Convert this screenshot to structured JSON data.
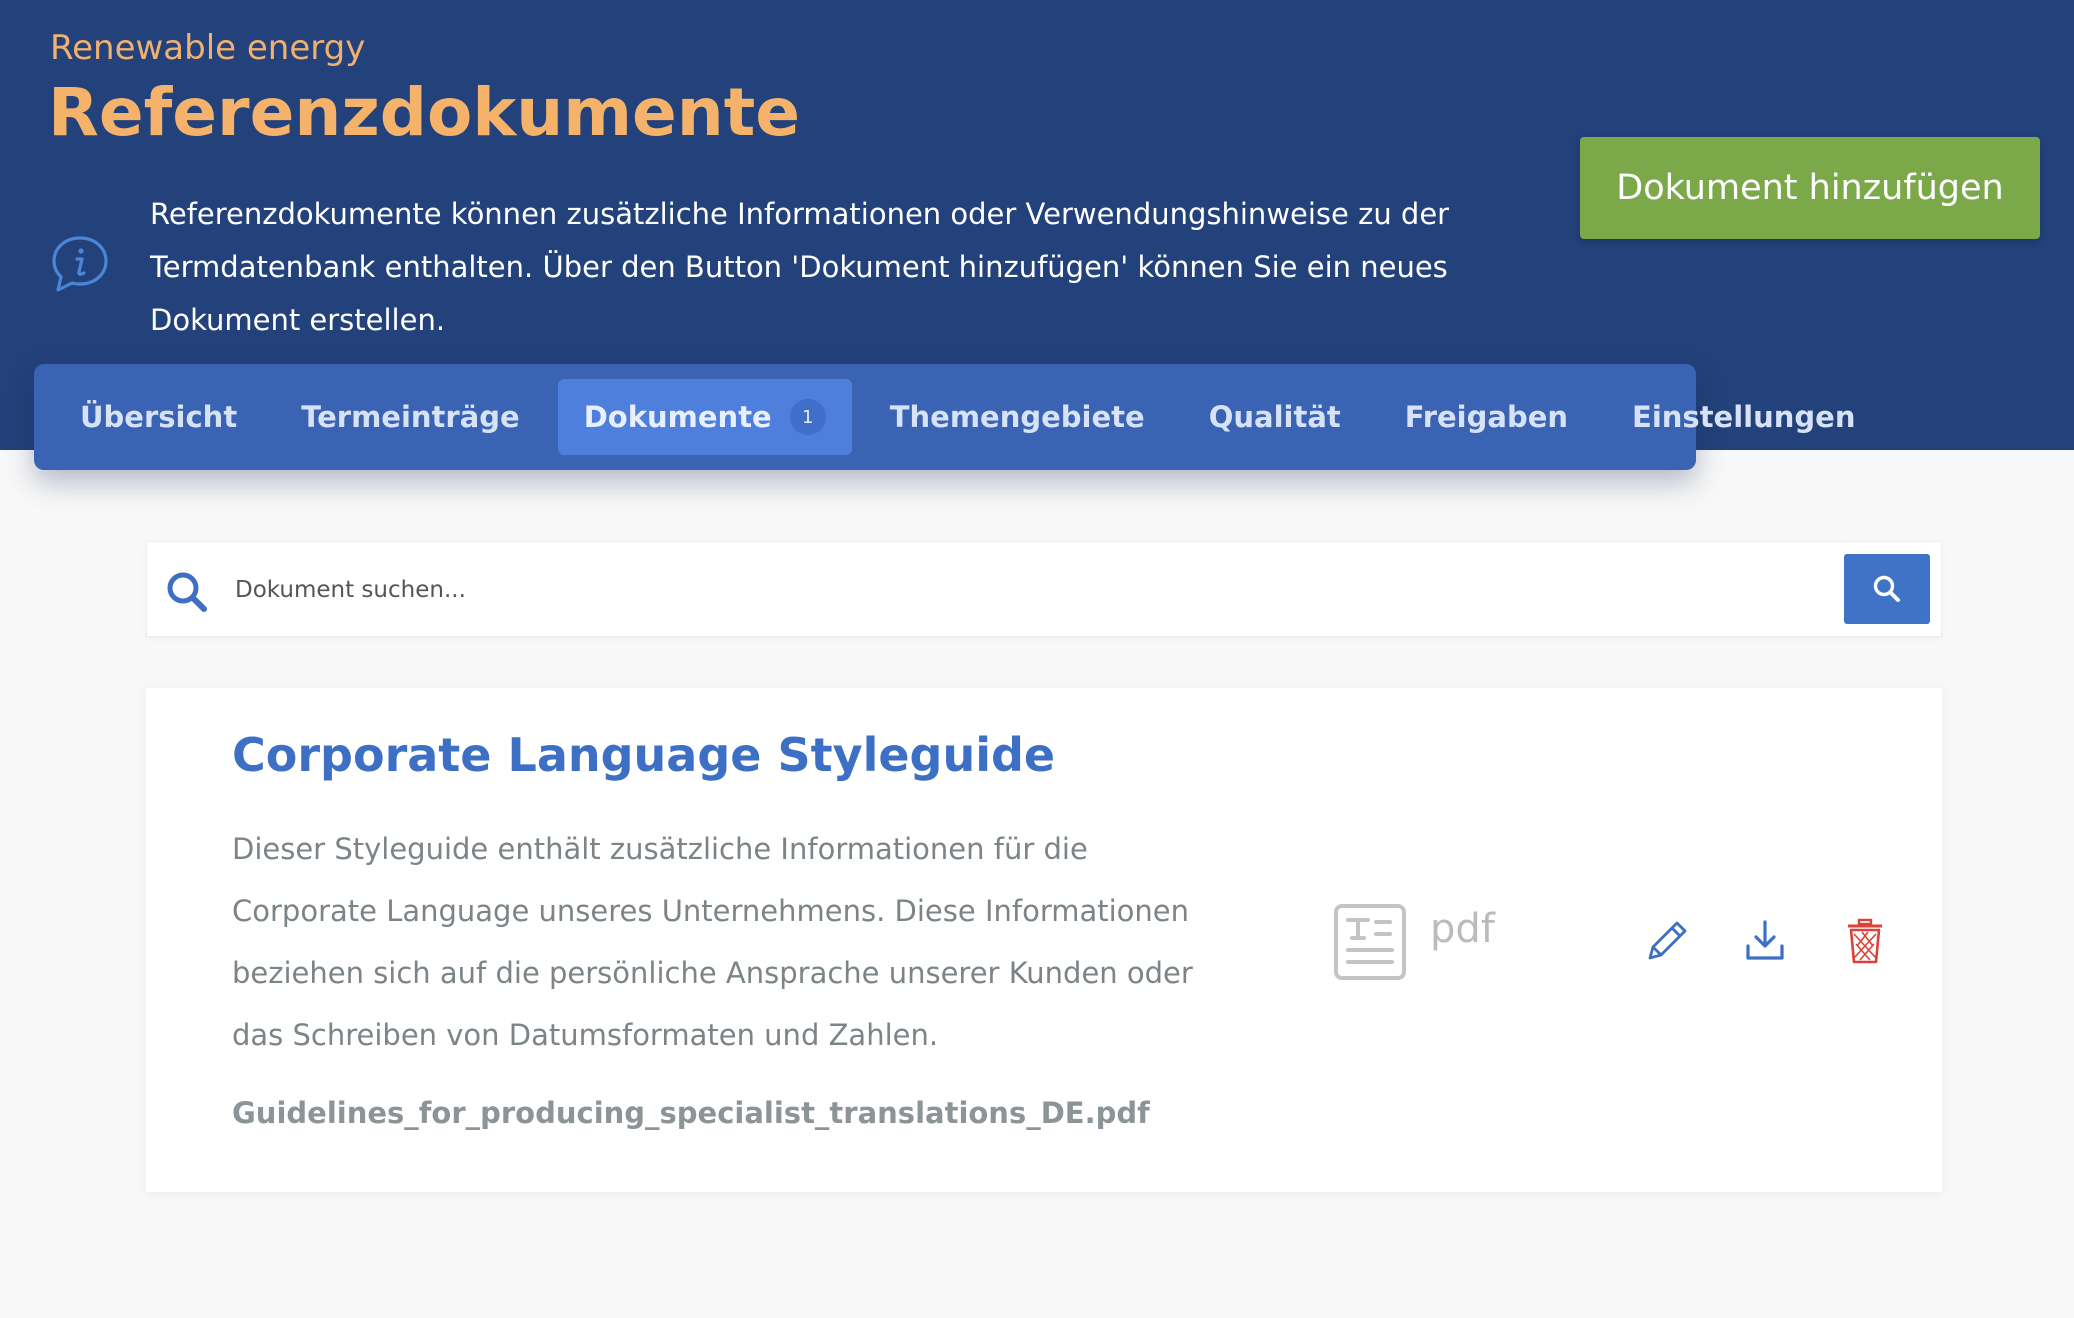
{
  "header": {
    "project_name": "Renewable energy",
    "page_title": "Referenzdokumente",
    "info_text": "Referenzdokumente können zusätzliche Informationen oder Verwendungshinweise zu der Termdatenbank enthalten. Über den Button 'Dokument hinzufügen' können Sie ein neues Dokument erstellen.",
    "add_button_label": "Dokument hinzufügen"
  },
  "tabs": [
    {
      "label": "Übersicht"
    },
    {
      "label": "Termeinträge"
    },
    {
      "label": "Dokumente",
      "badge": "1",
      "active": true
    },
    {
      "label": "Themengebiete"
    },
    {
      "label": "Qualität"
    },
    {
      "label": "Freigaben"
    },
    {
      "label": "Einstellungen"
    }
  ],
  "search": {
    "placeholder": "Dokument suchen...",
    "value": ""
  },
  "documents": [
    {
      "title": "Corporate Language Styleguide",
      "description": "Dieser Styleguide enthält zusätzliche Informationen für die Corporate Language unseres Unternehmens. Diese Informationen beziehen sich auf die persönliche Ansprache unserer Kunden oder das Schreiben von Datumsformaten und Zahlen.",
      "filename": "Guidelines_for_producing_specialist_translations_DE.pdf",
      "file_type": "pdf",
      "file_type_icon": "document-text-icon",
      "actions": [
        "edit-icon",
        "download-icon",
        "delete-icon"
      ]
    }
  ],
  "colors": {
    "header_bg": "#23417a",
    "title_accent": "#f5b26b",
    "tabs_bg": "#3a63b3",
    "tab_active_bg": "#4e7fdc",
    "add_button": "#7ba94a",
    "primary_blue": "#3d6fc4",
    "delete_red": "#d9433a"
  }
}
